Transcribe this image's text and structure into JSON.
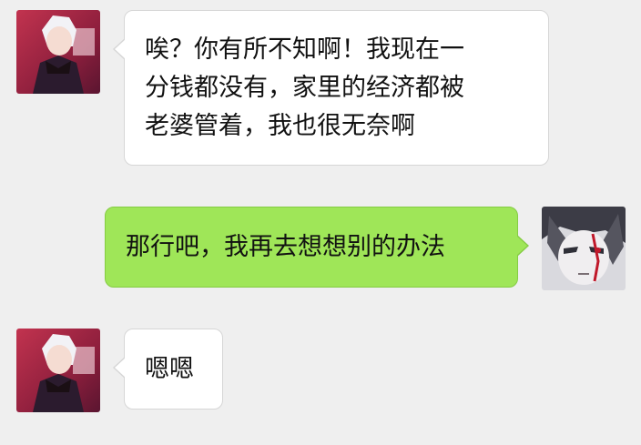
{
  "messages": [
    {
      "side": "received",
      "avatar": "contact-avatar",
      "text": "唉？你有所不知啊！我现在一\n分钱都没有，家里的经济都被\n老婆管着，我也很无奈啊"
    },
    {
      "side": "sent",
      "avatar": "self-avatar",
      "text": "那行吧，我再去想想别的办法"
    },
    {
      "side": "received",
      "avatar": "contact-avatar",
      "text": "嗯嗯"
    }
  ],
  "colors": {
    "background": "#efefef",
    "received_bubble": "#ffffff",
    "sent_bubble": "#9fe658",
    "text": "#111111"
  }
}
